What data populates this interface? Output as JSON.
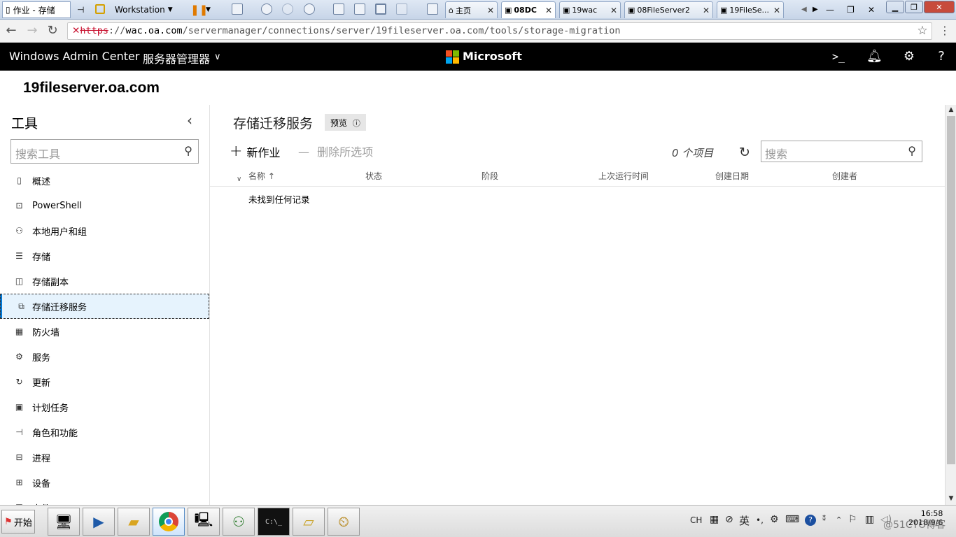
{
  "vm_toolbar": {
    "tab_first": "作业 - 存储",
    "workstation_label": "Workstation",
    "tabs": [
      "主页",
      "08DC",
      "19wac",
      "08FileServer2",
      "19FileSe..."
    ]
  },
  "browser": {
    "url_scheme": "https",
    "url_host": "wac.oa.com",
    "url_path": "/servermanager/connections/server/19fileserver.oa.com/tools/storage-migration"
  },
  "header": {
    "app_name": "Windows Admin Center",
    "solution_label": "服务器管理器",
    "brand": "Microsoft"
  },
  "server_name": "19fileserver.oa.com",
  "tools": {
    "title": "工具",
    "search_placeholder": "搜索工具",
    "items": [
      {
        "label": "概述",
        "icon": "overview-icon"
      },
      {
        "label": "PowerShell",
        "icon": "powershell-icon"
      },
      {
        "label": "本地用户和组",
        "icon": "users-icon"
      },
      {
        "label": "存储",
        "icon": "storage-icon"
      },
      {
        "label": "存储副本",
        "icon": "storage-replica-icon"
      },
      {
        "label": "存储迁移服务",
        "icon": "storage-migration-icon"
      },
      {
        "label": "防火墙",
        "icon": "firewall-icon"
      },
      {
        "label": "服务",
        "icon": "services-icon"
      },
      {
        "label": "更新",
        "icon": "updates-icon"
      },
      {
        "label": "计划任务",
        "icon": "scheduled-tasks-icon"
      },
      {
        "label": "角色和功能",
        "icon": "roles-features-icon"
      },
      {
        "label": "进程",
        "icon": "processes-icon"
      },
      {
        "label": "设备",
        "icon": "devices-icon"
      },
      {
        "label": "事件",
        "icon": "events-icon"
      }
    ],
    "active_index": 5
  },
  "main": {
    "title": "存储迁移服务",
    "preview_badge": "预览",
    "new_job": "新作业",
    "delete_selected": "删除所选项",
    "item_count": "0 个项目",
    "search_placeholder": "搜索",
    "columns": [
      "名称",
      "状态",
      "阶段",
      "上次运行时间",
      "创建日期",
      "创建者"
    ],
    "sort_column": "名称",
    "empty_message": "未找到任何记录"
  },
  "taskbar": {
    "start_label": "开始",
    "tray_lang": "CH",
    "tray_ime": "英",
    "time": "16:58",
    "date": "2018/9/6",
    "watermark": "@51CTO博客"
  },
  "colors": {
    "accent": "#0078d7",
    "header_bg": "#000000",
    "active_item_bg": "#e6f3fd"
  }
}
